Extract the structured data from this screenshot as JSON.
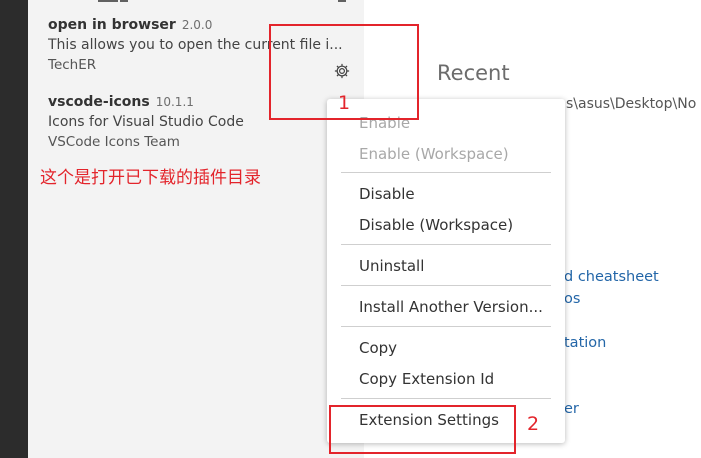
{
  "extensions": [
    {
      "name": "open in browser",
      "version": "2.0.0",
      "description": "This allows you to open the current file i...",
      "publisher": "TechER"
    },
    {
      "name": "vscode-icons",
      "version": "10.1.1",
      "description": "Icons for Visual Studio Code",
      "publisher": "VSCode Icons Team"
    }
  ],
  "annotation_text": "这个是打开已下载的插件目录",
  "annotations": {
    "num1": "1",
    "num2": "2"
  },
  "icons": {
    "gear": "gear-icon"
  },
  "welcome": {
    "title": "Recent",
    "path_fragment": "s\\asus\\Desktop\\No",
    "links": [
      "d cheatsheet",
      "os",
      "tation",
      "er"
    ]
  },
  "context_menu": {
    "items": [
      {
        "label": "Enable",
        "disabled": true
      },
      {
        "label": "Enable (Workspace)",
        "disabled": true
      },
      {
        "label": "Disable",
        "disabled": false
      },
      {
        "label": "Disable (Workspace)",
        "disabled": false
      },
      {
        "label": "Uninstall",
        "disabled": false
      },
      {
        "label": "Install Another Version...",
        "disabled": false
      },
      {
        "label": "Copy",
        "disabled": false
      },
      {
        "label": "Copy Extension Id",
        "disabled": false
      },
      {
        "label": "Extension Settings",
        "disabled": false
      }
    ]
  },
  "colors": {
    "annotation_red": "#e3242b",
    "link_blue": "#2366a8",
    "panel_bg": "#f3f3f3",
    "dark_strip": "#2c2c2c"
  }
}
